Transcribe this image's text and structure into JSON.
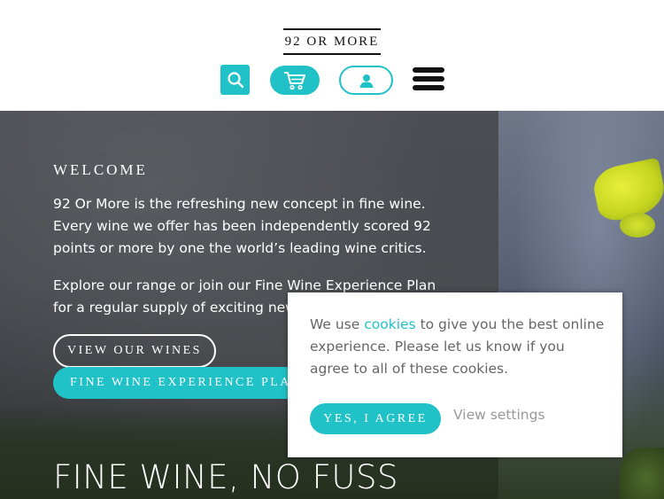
{
  "header": {
    "logo": "92 OR MORE",
    "icons": {
      "search": "search-icon",
      "cart": "cart-icon",
      "account": "user-icon",
      "menu": "hamburger-menu-icon"
    }
  },
  "hero": {
    "welcome": "WELCOME",
    "intro": "92 Or More is the refreshing new concept in fine wine. Every wine we offer has been independently scored 92 points or more by one the world’s leading wine critics.",
    "explore": "Explore our range or join our Fine Wine Experience Plan for a regular supply of exciting new wines.",
    "view_wines_label": "VIEW OUR WINES",
    "plan_label": "FINE WINE EXPERIENCE PLAN",
    "heading": "FINE WINE, NO FUSS"
  },
  "cookie": {
    "text_before": "We use ",
    "link_text": "cookies",
    "text_after": " to give you the best online experience. Please let us know if you agree to all of these cookies.",
    "agree_label": "YES, I AGREE",
    "settings_label": "View settings"
  },
  "colors": {
    "accent": "#21c2c7",
    "text_dark": "#111111",
    "cookie_text": "#666666"
  }
}
